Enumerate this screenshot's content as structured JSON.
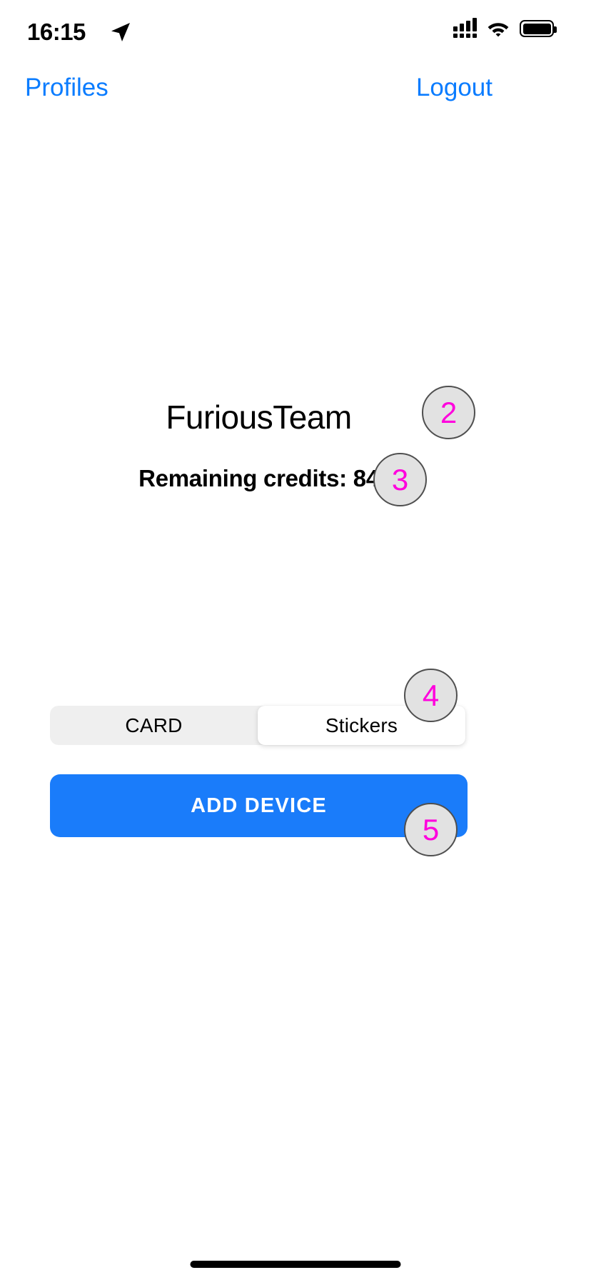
{
  "status_bar": {
    "time": "16:15",
    "location_icon": "location-arrow-icon",
    "cellular_icon": "cellular-bars-icon",
    "wifi_icon": "wifi-icon",
    "battery_icon": "battery-full-icon"
  },
  "nav_bar": {
    "left_label": "Profiles",
    "right_label": "Logout",
    "link_color": "#0a7cff"
  },
  "main": {
    "team_name": "FuriousTeam",
    "credits_text": "Remaining credits: 84",
    "credits_value": "84"
  },
  "segmented_control": {
    "options": [
      {
        "label": "CARD",
        "selected": false
      },
      {
        "label": "Stickers",
        "selected": true
      }
    ],
    "selected_index": 1,
    "track_color": "#efefef",
    "selected_color": "#ffffff"
  },
  "primary_button": {
    "label": "ADD DEVICE",
    "color": "#1a7cfa",
    "text_color": "#ffffff"
  },
  "annotations": {
    "badge_color": "#e2e2e2",
    "badge_border_color": "#4f4f4f",
    "badge_text_color": "#ff00dd",
    "items": [
      {
        "number": "2",
        "target": "team-name"
      },
      {
        "number": "3",
        "target": "credits-line"
      },
      {
        "number": "4",
        "target": "segmented-control"
      },
      {
        "number": "5",
        "target": "add-device-button"
      }
    ]
  },
  "home_indicator": {
    "label": "home-indicator"
  }
}
